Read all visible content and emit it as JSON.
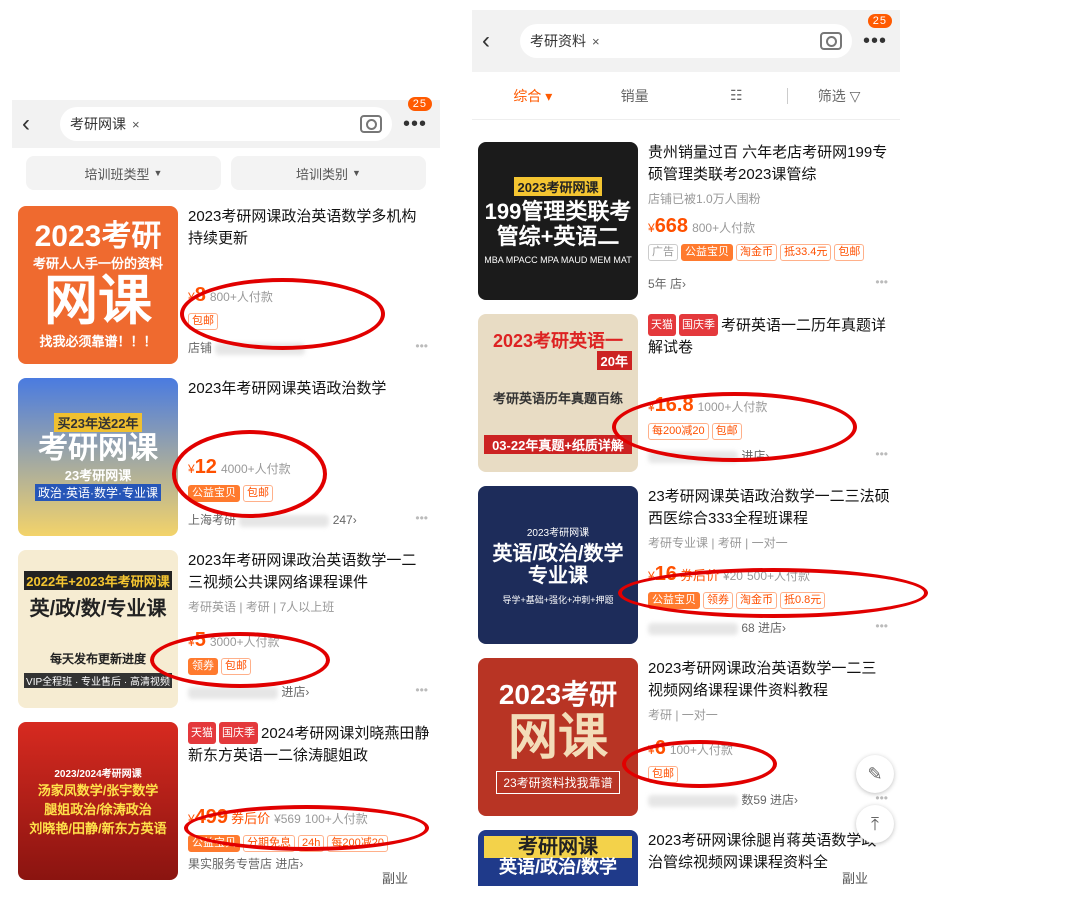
{
  "left": {
    "search": {
      "query": "考研网课",
      "badge": "25"
    },
    "filters": [
      "培训班类型",
      "培训类别"
    ],
    "products": [
      {
        "thumb": {
          "l1": "考研人人手一份的资料",
          "l2": "2023考研",
          "l3": "网课",
          "l4": "找我必须靠谱！！！"
        },
        "title": "2023考研网课政治英语数学多机构持续更新",
        "price": "8",
        "paid": "800+人付款",
        "tags": [
          "包邮"
        ],
        "shop": "店铺"
      },
      {
        "thumb": {
          "l1": "买23年送22年",
          "l2": "考研网课",
          "l3": "23考研网课",
          "l4": "政治·英语·数学·专业课"
        },
        "title": "2023年考研网课英语政治数学",
        "price": "12",
        "paid": "4000+人付款",
        "tags": [
          "公益宝贝",
          "包邮"
        ],
        "shop": "247",
        "shop_prefix": "上海考研"
      },
      {
        "thumb": {
          "l1": "2022年+2023年考研网课",
          "l2": "英/政/数/专业课",
          "l3": "每天发布更新进度",
          "l4": "VIP全程班 · 专业售后 · 高清视频"
        },
        "title": "2023年考研网课政治英语数学一二三视频公共课网络课程课件",
        "sub": "考研英语 | 考研 | 7人以上班",
        "price": "5",
        "paid": "3000+人付款",
        "tags": [
          "领券",
          "包邮"
        ],
        "shop": "进店"
      },
      {
        "thumb": {
          "l1": "2023/2024考研网课",
          "l2": "汤家凤数学/张宇数学",
          "l3": "腿姐政治/徐涛政治",
          "l4": "刘晓艳/田静/新东方英语"
        },
        "badges": [
          "天猫",
          "国庆季"
        ],
        "title": "2024考研网课刘晓燕田静新东方英语一二徐涛腿姐政",
        "price": "499",
        "coupon": "券后价",
        "orig": "¥569",
        "paid": "100+人付款",
        "tags": [
          "公益宝贝",
          "分期免息",
          "24h",
          "每200减20"
        ],
        "shop": "果实服务专营店 进店"
      }
    ],
    "watermark": "副业"
  },
  "right": {
    "search": {
      "query": "考研资料",
      "badge": "25"
    },
    "sort": [
      "综合",
      "销量",
      "筛选"
    ],
    "products": [
      {
        "thumb": {
          "l1": "2023考研网课",
          "l2": "199管理类联考",
          "l3": "管综+英语二",
          "l4": "MBA MPACC MPA MAUD MEM MAT"
        },
        "title": "贵州销量过百 六年老店考研网199专硕管理类联考2023课管综",
        "sub": "店铺已被1.0万人围粉",
        "price": "668",
        "paid": "800+人付款",
        "tags": [
          "广告",
          "公益宝贝",
          "淘金币",
          "抵33.4元",
          "包邮"
        ],
        "shop": "5年 店"
      },
      {
        "thumb": {
          "l1": "2023考研英语一",
          "l2": "20年",
          "l3": "考研英语历年真题百练",
          "l4": "03-22年真题+纸质详解"
        },
        "badges": [
          "天猫",
          "国庆季"
        ],
        "title": "考研英语一二历年真题详解试卷",
        "price": "16.8",
        "paid": "1000+人付款",
        "tags": [
          "每200减20",
          "包邮"
        ],
        "shop": "进店"
      },
      {
        "thumb": {
          "l1": "2023考研网课",
          "l2": "英语/政治/数学",
          "l3": "专业课",
          "l4": "导学+基础+强化+冲刺+押题"
        },
        "title": "23考研网课英语政治数学一二三法硕西医综合333全程班课程",
        "sub": "考研专业课 | 考研 | 一对一",
        "price": "16",
        "coupon": "券后价",
        "orig": "¥20",
        "paid": "500+人付款",
        "tags": [
          "公益宝贝",
          "领券",
          "淘金币",
          "抵0.8元"
        ],
        "shop": "68 进店"
      },
      {
        "thumb": {
          "l1": "",
          "l2": "2023考研",
          "l3": "网课",
          "l4": "23考研资料找我靠谱"
        },
        "title": "2023考研网课政治英语数学一二三视频网络课程课件资料教程",
        "sub": "考研 | 一对一",
        "price": "6",
        "paid": "100+人付款",
        "tags": [
          "包邮"
        ],
        "shop": "数59 进店"
      },
      {
        "thumb": {
          "l1": "考研网课",
          "l2": "英语/政治/数学",
          "l3": "",
          "l4": ""
        },
        "title": "2023考研网课徐腿肖蒋英语数学政治管综视频网课课程资料全",
        "price": "",
        "paid": "",
        "tags": [],
        "shop": ""
      }
    ],
    "watermark": "副业"
  },
  "colors": {
    "accent": "#ff5000",
    "annotation": "#e10000"
  }
}
